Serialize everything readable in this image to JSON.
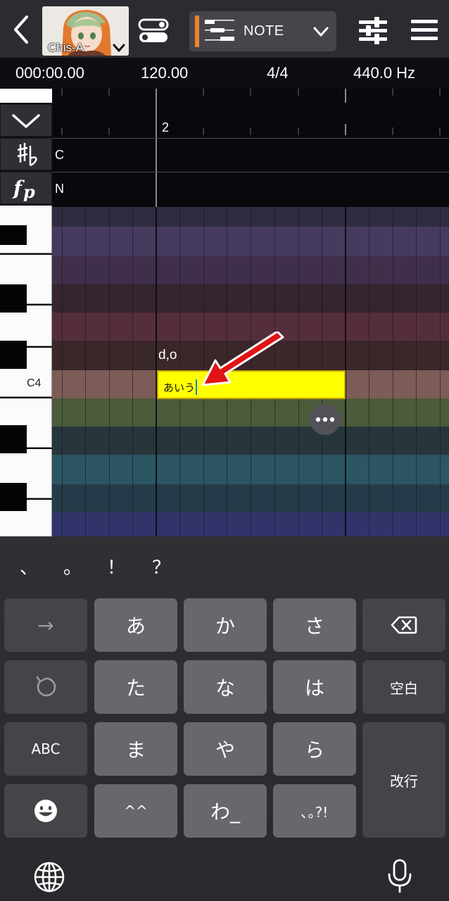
{
  "header": {
    "avatar_name": "Chis-A",
    "mode_label": "NOTE",
    "accent_color": "#f0822a"
  },
  "status": {
    "time": "000:00.00",
    "tempo": "120.00",
    "time_signature": "4/4",
    "pitch_ref": "440.0 Hz"
  },
  "editor": {
    "ruler_measure": "2",
    "key_row_value": "C",
    "dynamics_row_value": "N",
    "c4_label": "C4",
    "lyric_label": "d,o",
    "note_text": "あいう",
    "note_color": "#ffff00"
  },
  "keyboard": {
    "punctuation": [
      "、",
      "。",
      "！",
      "？"
    ],
    "rows": [
      [
        "→",
        "あ",
        "か",
        "さ",
        "delete"
      ],
      [
        "undo",
        "た",
        "な",
        "は",
        "空白"
      ],
      [
        "ABC",
        "ま",
        "や",
        "ら",
        "改行"
      ],
      [
        "emoji",
        "^^",
        "わ_",
        "､｡?!"
      ]
    ],
    "keys": {
      "arrow": "→",
      "a": "あ",
      "ka": "か",
      "sa": "さ",
      "ta": "た",
      "na": "な",
      "ha": "は",
      "space": "空白",
      "abc": "ABC",
      "ma": "ま",
      "ya": "や",
      "ra": "ら",
      "enter": "改行",
      "kaomoji": "^^",
      "wa": "わ_",
      "punct": "､｡?!"
    },
    "icons": [
      "backspace-icon",
      "undo-icon",
      "emoji-icon",
      "globe-icon",
      "microphone-icon"
    ]
  }
}
